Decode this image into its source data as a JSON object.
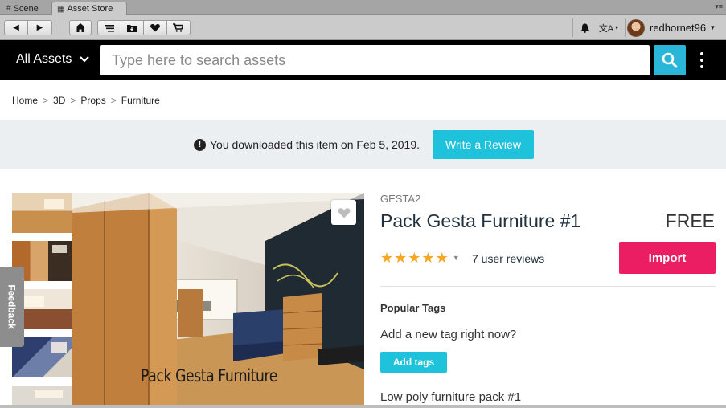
{
  "tabs": [
    {
      "label": "Scene",
      "icon": "grid-icon"
    },
    {
      "label": "Asset Store",
      "icon": "store-icon"
    }
  ],
  "toolbar": {
    "icons": [
      "back-icon",
      "forward-icon",
      "home-icon",
      "menu-list-icon",
      "downloads-folder-icon",
      "heart-icon",
      "cart-icon",
      "bell-icon",
      "language-icon"
    ],
    "language_symbol": "文A",
    "username": "redhornet96"
  },
  "header": {
    "category_label": "All Assets",
    "search_placeholder": "Type here to search assets"
  },
  "breadcrumb": [
    "Home",
    "3D",
    "Props",
    "Furniture"
  ],
  "banner": {
    "message": "You downloaded this item on Feb 5, 2019.",
    "button_label": "Write a Review"
  },
  "feedback_label": "Feedback",
  "product": {
    "publisher": "GESTA2",
    "title": "Pack Gesta Furniture #1",
    "price": "FREE",
    "rating": 5,
    "reviews_label": "7 user reviews",
    "import_label": "Import",
    "image_caption": "Pack Gesta Furniture",
    "popular_tags_heading": "Popular Tags",
    "add_tag_prompt": "Add a new tag right now?",
    "add_tags_label": "Add tags",
    "description": "Low poly furniture pack #1"
  },
  "colors": {
    "accent_cyan": "#1ec3db",
    "import_pink": "#ec1e63",
    "star_orange": "#f5a623",
    "header_black": "#000000"
  }
}
